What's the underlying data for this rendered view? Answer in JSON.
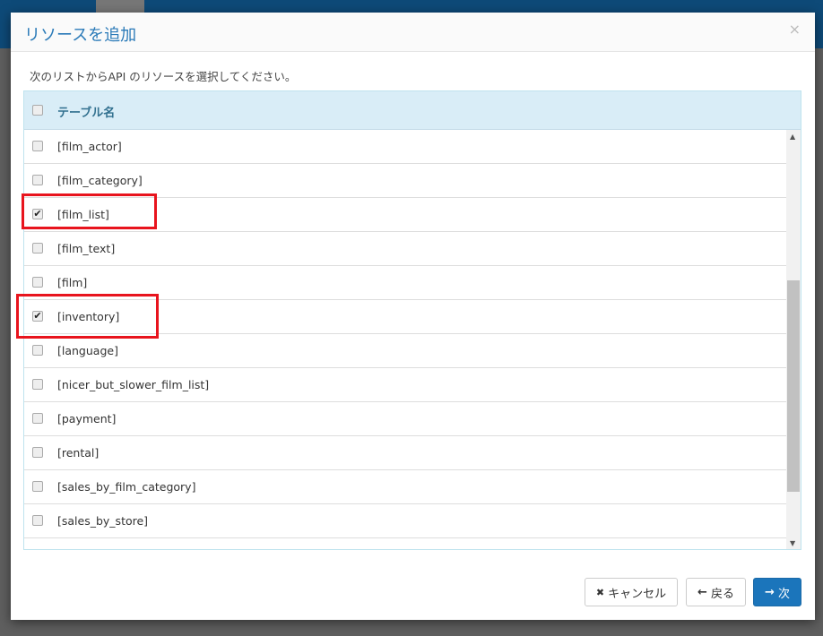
{
  "modal": {
    "title": "リソースを追加",
    "close_icon": "×",
    "description": "次のリストからAPI のリソースを選択してください。"
  },
  "table": {
    "header": "テーブル名",
    "rows": [
      {
        "name": "[film_actor]",
        "checked": false
      },
      {
        "name": "[film_category]",
        "checked": false
      },
      {
        "name": "[film_list]",
        "checked": true
      },
      {
        "name": "[film_text]",
        "checked": false
      },
      {
        "name": "[film]",
        "checked": false
      },
      {
        "name": "[inventory]",
        "checked": true
      },
      {
        "name": "[language]",
        "checked": false
      },
      {
        "name": "[nicer_but_slower_film_list]",
        "checked": false
      },
      {
        "name": "[payment]",
        "checked": false
      },
      {
        "name": "[rental]",
        "checked": false
      },
      {
        "name": "[sales_by_film_category]",
        "checked": false
      },
      {
        "name": "[sales_by_store]",
        "checked": false
      }
    ]
  },
  "buttons": {
    "cancel": "キャンセル",
    "back": "戻る",
    "next": "次"
  },
  "icons": {
    "cancel": "✖",
    "back": "🡐",
    "next": "➔",
    "check": "✔"
  },
  "colors": {
    "accent": "#1b75bb",
    "highlight": "#e8141d"
  }
}
